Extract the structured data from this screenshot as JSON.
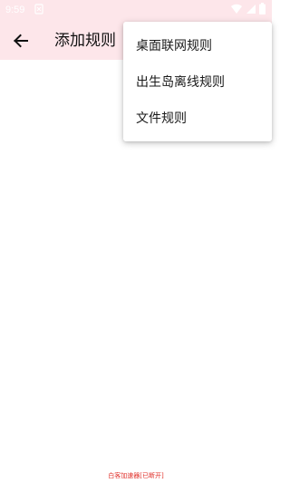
{
  "status_bar": {
    "time": "9:59",
    "icons": {
      "notification": "notification-icon",
      "wifi": "wifi-icon",
      "signal": "signal-icon",
      "battery": "battery-icon"
    }
  },
  "app_bar": {
    "back_icon": "arrow-left-icon",
    "title": "添加规则"
  },
  "overflow_menu": {
    "items": [
      {
        "label": "桌面联网规则"
      },
      {
        "label": "出生岛离线规则"
      },
      {
        "label": "文件规则"
      }
    ]
  },
  "footer": {
    "status_text": "白客加速器[已断开]"
  },
  "colors": {
    "app_bar_bg": "#fde6ea",
    "footer_text": "#e0302a"
  }
}
